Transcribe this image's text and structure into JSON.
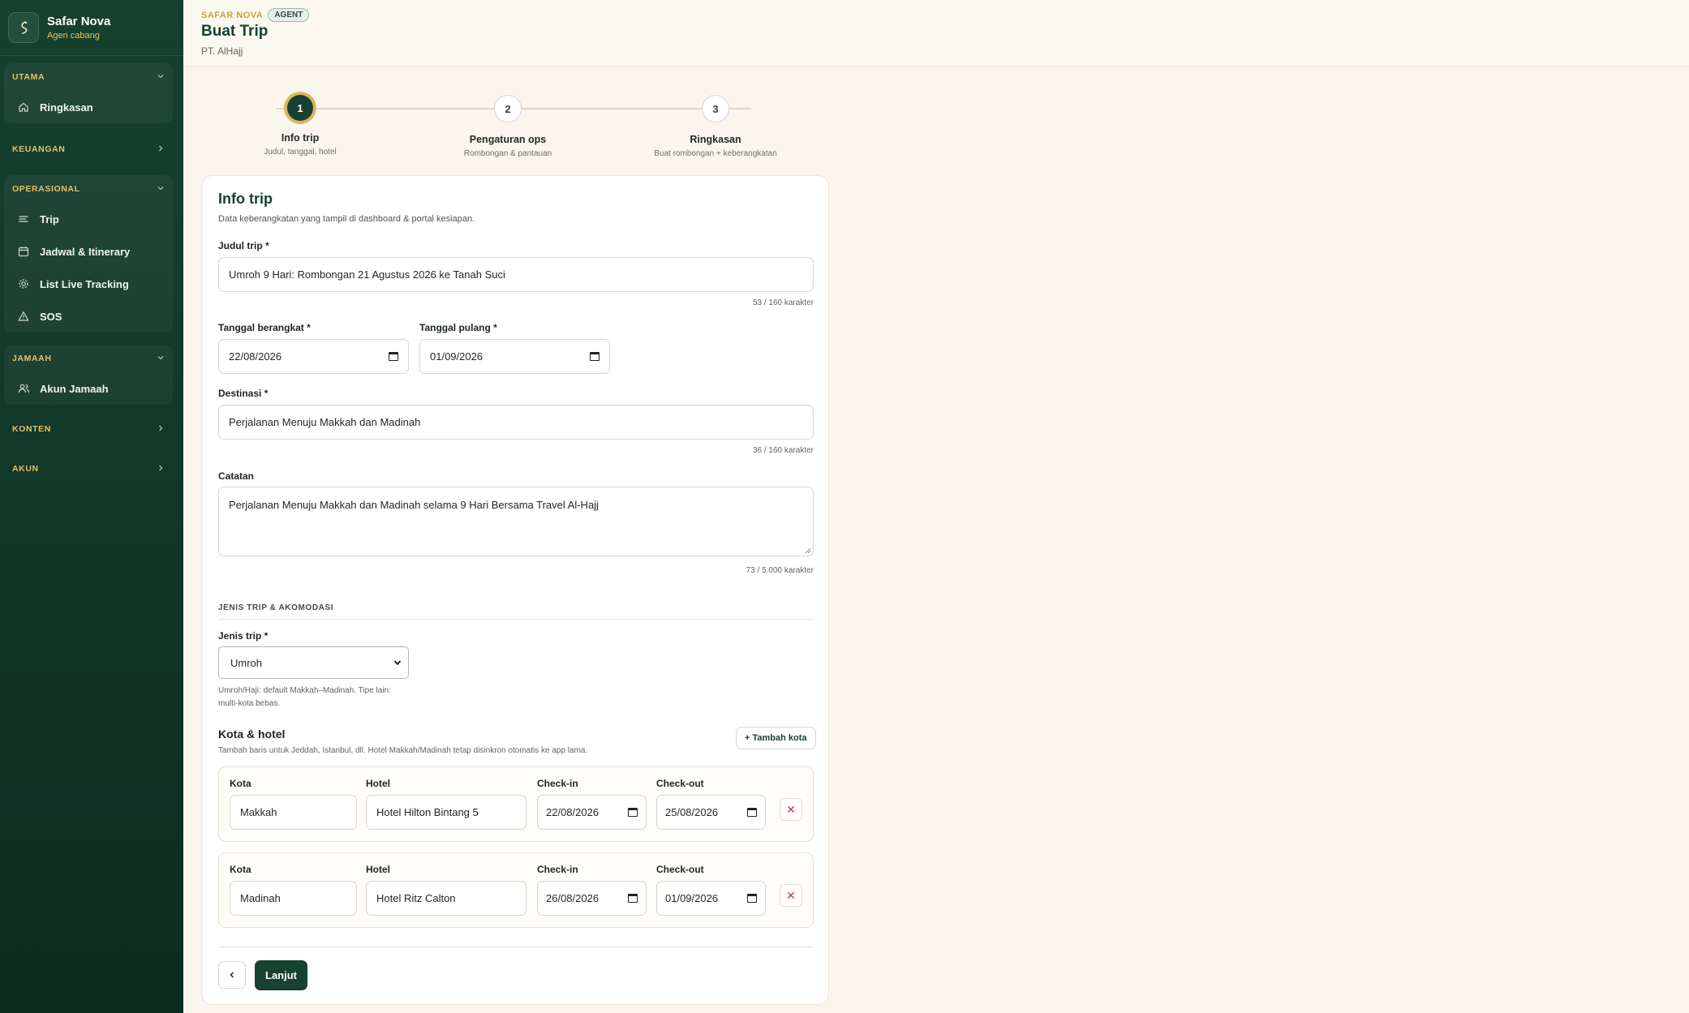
{
  "sidebar": {
    "brand_name": "Safar Nova",
    "brand_sub": "Agen cabang",
    "groups": [
      {
        "label": "UTAMA",
        "items": [
          {
            "label": "Ringkasan"
          }
        ]
      },
      {
        "label": "KEUANGAN"
      },
      {
        "label": "OPERASIONAL",
        "items": [
          {
            "label": "Trip"
          },
          {
            "label": "Jadwal & Itinerary"
          },
          {
            "label": "List Live Tracking"
          },
          {
            "label": "SOS"
          }
        ]
      },
      {
        "label": "JAMAAH",
        "items": [
          {
            "label": "Akun Jamaah"
          }
        ]
      },
      {
        "label": "KONTEN"
      },
      {
        "label": "AKUN"
      }
    ]
  },
  "header": {
    "crumb_brand": "SAFAR NOVA",
    "badge": "AGENT",
    "title": "Buat Trip",
    "subtitle": "PT. AlHajj"
  },
  "stepper": [
    {
      "num": "1",
      "title": "Info trip",
      "desc": "Judul, tanggal, hotel"
    },
    {
      "num": "2",
      "title": "Pengaturan ops",
      "desc": "Rombongan & pantauan"
    },
    {
      "num": "3",
      "title": "Ringkasan",
      "desc": "Buat rombongan + keberangkatan"
    }
  ],
  "form": {
    "heading": "Info trip",
    "description": "Data keberangkatan yang tampil di dashboard & portal kesiapan.",
    "judul_label": "Judul trip *",
    "judul_value": "Umroh 9 Hari: Rombongan 21 Agustus 2026 ke Tanah Suci",
    "judul_counter": "53 / 160 karakter",
    "berangkat_label": "Tanggal berangkat *",
    "berangkat_value": "22/08/2026",
    "pulang_label": "Tanggal pulang *",
    "pulang_value": "01/09/2026",
    "destinasi_label": "Destinasi *",
    "destinasi_value": "Perjalanan Menuju Makkah dan Madinah",
    "destinasi_counter": "36 / 160 karakter",
    "catatan_label": "Catatan",
    "catatan_value": "Perjalanan Menuju Makkah dan Madinah selama 9 Hari Bersama Travel Al-Hajj",
    "catatan_counter": "73 / 5.000 karakter",
    "section_head": "JENIS TRIP & AKOMODASI",
    "jenis_label": "Jenis trip *",
    "jenis_value": "Umroh",
    "jenis_hint": "Umroh/Haji: default Makkah–Madinah. Tipe lain: multi-kota bebas.",
    "kota_heading": "Kota & hotel",
    "kota_desc": "Tambah baris untuk Jeddah, Istanbul, dll. Hotel Makkah/Madinah tetap disinkron otomatis ke app lama.",
    "add_city_label": "+ Tambah kota",
    "col_kota": "Kota",
    "col_hotel": "Hotel",
    "col_checkin": "Check-in",
    "col_checkout": "Check-out",
    "cities": [
      {
        "kota": "Makkah",
        "hotel": "Hotel Hilton Bintang 5",
        "checkin": "22/08/2026",
        "checkout": "25/08/2026"
      },
      {
        "kota": "Madinah",
        "hotel": "Hotel Ritz Calton",
        "checkin": "26/08/2026",
        "checkout": "01/09/2026"
      }
    ],
    "next_label": "Lanjut"
  },
  "colors": {
    "primary": "#174131",
    "accent": "#d9b95c",
    "danger": "#c23a3a"
  }
}
